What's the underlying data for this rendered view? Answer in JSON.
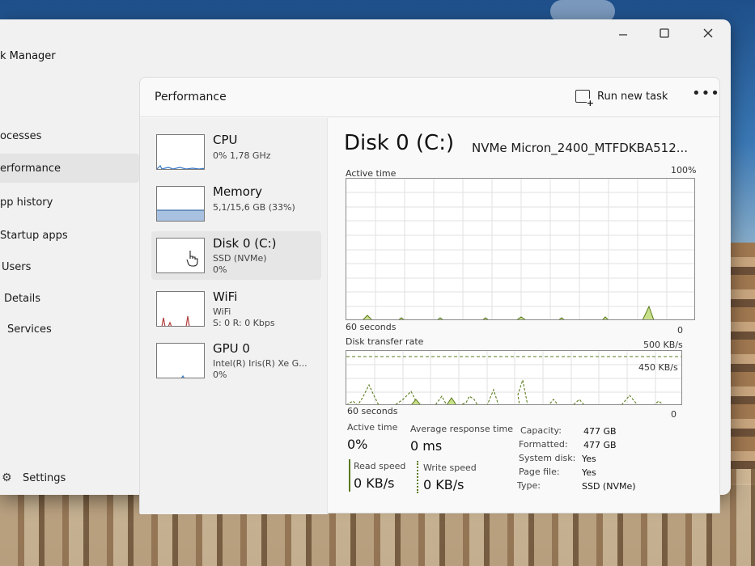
{
  "window": {
    "title": "k Manager",
    "min_icon": "minimize-icon",
    "max_icon": "maximize-icon",
    "close_icon": "close-icon"
  },
  "nav": {
    "items": [
      {
        "label": "ocesses"
      },
      {
        "label": "erformance"
      },
      {
        "label": "pp history"
      },
      {
        "label": "Startup apps"
      },
      {
        "label": "Users"
      },
      {
        "label": "Details"
      },
      {
        "label": "Services"
      }
    ],
    "settings_label": "Settings"
  },
  "panel": {
    "title": "Performance",
    "run_task_label": "Run new task",
    "more_label": "•••"
  },
  "resources": [
    {
      "name": "CPU",
      "lines": [
        "0% 1,78 GHz"
      ]
    },
    {
      "name": "Memory",
      "lines": [
        "5,1/15,6 GB (33%)"
      ]
    },
    {
      "name": "Disk 0 (C:)",
      "lines": [
        "SSD (NVMe)",
        "0%"
      ]
    },
    {
      "name": "WiFi",
      "lines": [
        "WiFi",
        "S: 0 R: 0 Kbps"
      ]
    },
    {
      "name": "GPU 0",
      "lines": [
        "Intel(R) Iris(R) Xe G...",
        "0%"
      ]
    }
  ],
  "detail": {
    "title": "Disk 0 (C:)",
    "model": "NVMe Micron_2400_MTFDKBA512...",
    "active_time_label": "Active time",
    "active_time_max": "100%",
    "active_time_xlabel": "60 seconds",
    "active_time_min": "0",
    "transfer_label": "Disk transfer rate",
    "transfer_max": "500 KB/s",
    "transfer_mark": "450 KB/s",
    "transfer_xlabel": "60 seconds",
    "transfer_min": "0"
  },
  "stats": {
    "active_time_label": "Active time",
    "active_time_value": "0%",
    "response_label": "Average response time",
    "response_value": "0 ms",
    "read_label": "Read speed",
    "read_value": "0 KB/s",
    "write_label": "Write speed",
    "write_value": "0 KB/s",
    "properties": [
      {
        "label": "Capacity:",
        "value": "477 GB"
      },
      {
        "label": "Formatted:",
        "value": "477 GB"
      },
      {
        "label": "System disk:",
        "value": "Yes"
      },
      {
        "label": "Page file:",
        "value": "Yes"
      },
      {
        "label": "Type:",
        "value": "SSD (NVMe)"
      }
    ]
  },
  "colors": {
    "disk_line": "#5a7a1c",
    "disk_fill": "#c9e08a",
    "read_bar": "#5a7a1c",
    "write_bar": "#5a7a1c",
    "mem_fill": "#a9c1e0",
    "cpu_line": "#3a7ac8",
    "wifi_line": "#b43c3c"
  }
}
